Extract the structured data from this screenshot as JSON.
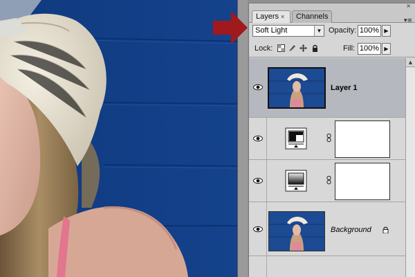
{
  "panel": {
    "tabs": [
      {
        "label": "Layers",
        "close": "×",
        "active": true
      },
      {
        "label": "Channels",
        "active": false
      }
    ],
    "close_glyph": "×",
    "menu_glyph": "▾≡"
  },
  "blend": {
    "value": "Soft Light",
    "dropdown_glyph": "▼"
  },
  "opacity": {
    "label": "Opacity:",
    "value": "100%"
  },
  "lock": {
    "label": "Lock:",
    "icons": [
      "lock-transparent-icon",
      "lock-image-icon",
      "lock-position-icon",
      "lock-all-icon"
    ]
  },
  "fill": {
    "label": "Fill:",
    "value": "100%"
  },
  "spin_glyph": "▶",
  "layers": [
    {
      "name": "Layer 1",
      "selected": true,
      "visible": true,
      "kind": "photo"
    },
    {
      "name": "",
      "selected": false,
      "visible": true,
      "kind": "levels-adjustment",
      "more": "..."
    },
    {
      "name": "",
      "selected": false,
      "visible": true,
      "kind": "gradient-map-adjustment",
      "more": "..."
    },
    {
      "name": "Background",
      "selected": false,
      "visible": true,
      "kind": "photo",
      "locked": true
    }
  ],
  "scroll_up_glyph": "▲",
  "colors": {
    "canvas_blue": "#123f86",
    "arrow_red": "#a0191c",
    "selected_row": "#b6b8bf",
    "panel_bg": "#d4d4d4"
  }
}
